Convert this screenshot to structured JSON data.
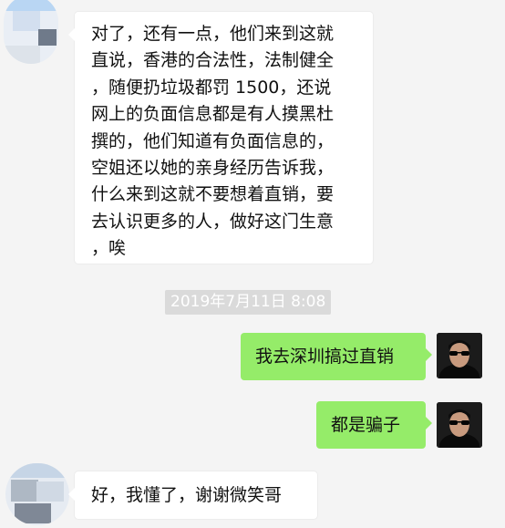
{
  "messages": [
    {
      "side": "left",
      "lines": [
        "对了，还有一点，他们来到这就",
        "直说，香港的合法性，法制健全",
        "，随便扔垃圾都罚 1500，还说",
        "网上的负面信息都是有人摸黑杜",
        "撰的，他们知道有负面信息的，",
        "空姐还以她的亲身经历告诉我，",
        "什么来到这就不要想着直销，要",
        "去认识更多的人，做好这门生意",
        "，唉"
      ]
    },
    {
      "side": "right",
      "text": "我去深圳搞过直销"
    },
    {
      "side": "right",
      "text": "都是骗子"
    },
    {
      "side": "left",
      "text": "好，我懂了，谢谢微笑哥"
    }
  ],
  "timestamp": "2019年7月11日 8:08",
  "colors": {
    "background": "#f4f4f4",
    "left_bubble": "#ffffff",
    "right_bubble": "#95ec69",
    "timestamp_bg": "#dadada"
  },
  "icons": {
    "left_avatar": "blurred-avatar-icon",
    "right_avatar": "neo-sunglasses-avatar-icon"
  }
}
